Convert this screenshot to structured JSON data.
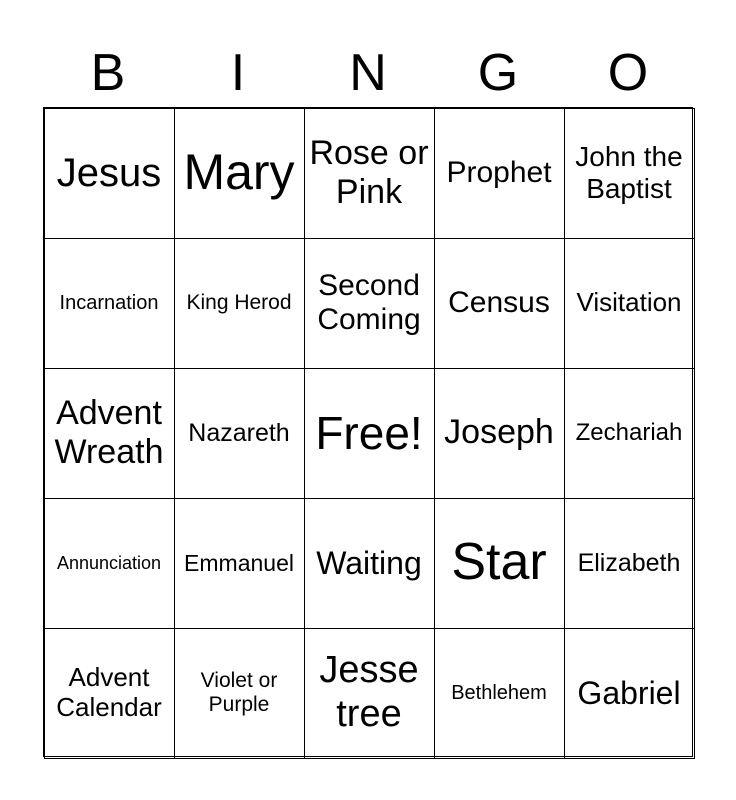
{
  "header": {
    "letters": [
      "B",
      "I",
      "N",
      "G",
      "O"
    ]
  },
  "cells": [
    [
      "Jesus",
      "Mary",
      "Rose or Pink",
      "Prophet",
      "John the Baptist"
    ],
    [
      "Incarnation",
      "King Herod",
      "Second Coming",
      "Census",
      "Visitation"
    ],
    [
      "Advent Wreath",
      "Nazareth",
      "Free!",
      "Joseph",
      "Zechariah"
    ],
    [
      "Annunciation",
      "Emmanuel",
      "Waiting",
      "Star",
      "Elizabeth"
    ],
    [
      "Advent Calendar",
      "Violet or Purple",
      "Jesse tree",
      "Bethlehem",
      "Gabriel"
    ]
  ]
}
